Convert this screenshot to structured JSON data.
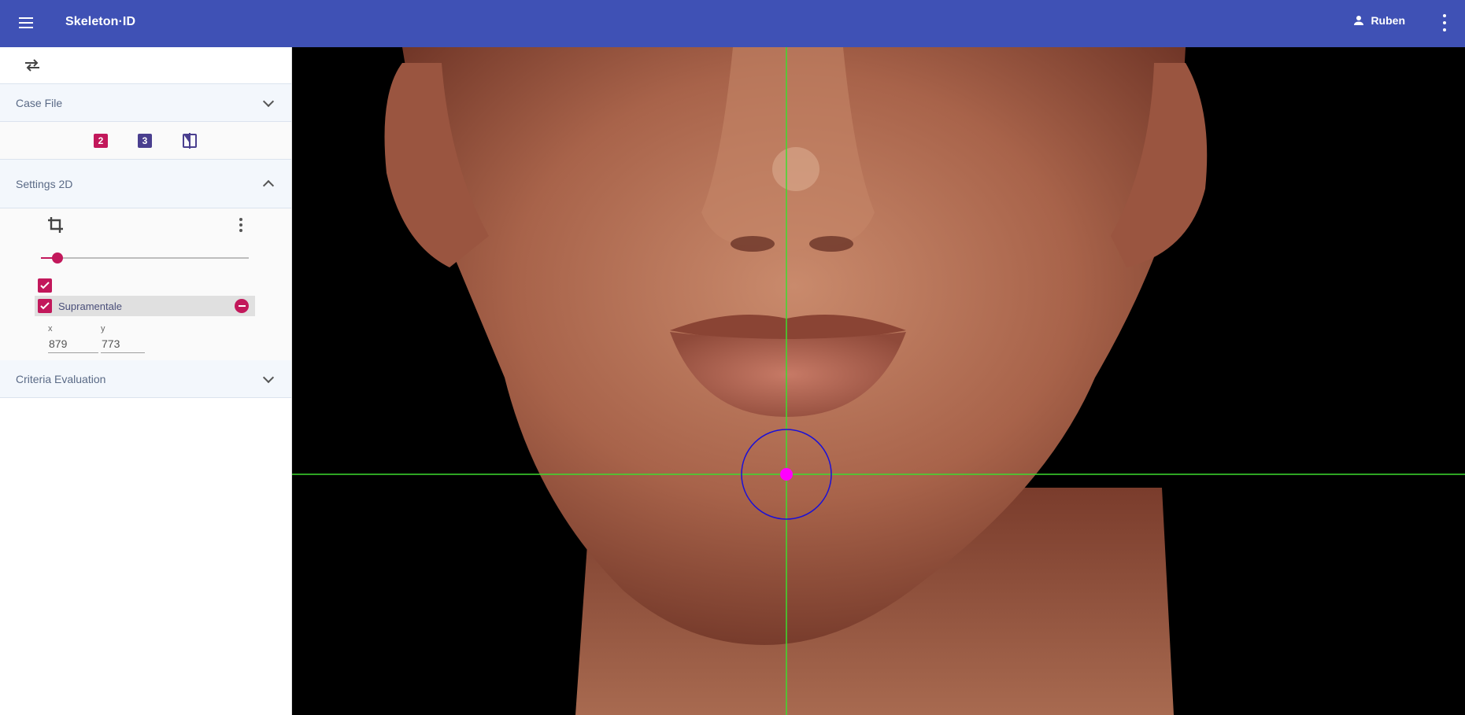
{
  "app": {
    "title": "Skeleton·ID"
  },
  "header": {
    "user_name": "Ruben",
    "user_icon": "person-icon",
    "menu_icon": "menu-icon",
    "more_icon": "more-vert-icon"
  },
  "sidebar": {
    "swap_icon": "swap-horiz-icon",
    "case_file": {
      "label": "Case File",
      "expanded": false
    },
    "modes": [
      {
        "label": "2",
        "icon": "mode-2d-icon",
        "color": "#c2185b"
      },
      {
        "label": "3",
        "icon": "mode-3d-icon",
        "color": "#4a3f8f"
      },
      {
        "label": "",
        "icon": "compare-icon",
        "color": "#4a3f8f"
      }
    ],
    "settings_2d": {
      "label": "Settings 2D",
      "expanded": true,
      "crop_icon": "crop-icon",
      "opacity_slider": {
        "value": 0.08
      },
      "landmark": {
        "name": "Supramentale",
        "checked": true,
        "x_label": "x",
        "y_label": "y",
        "x": "879",
        "y": "773"
      }
    },
    "criteria_evaluation": {
      "label": "Criteria Evaluation",
      "expanded": false
    }
  },
  "viewer": {
    "image": "frontal-face-photo",
    "crosshair_color": "#3ddc2f",
    "marker_color": "#ff00ff",
    "circle_color": "#1a10d8"
  },
  "colors": {
    "primary": "#3f51b5",
    "accent": "#c2185b",
    "mode3": "#4a3f8f"
  }
}
